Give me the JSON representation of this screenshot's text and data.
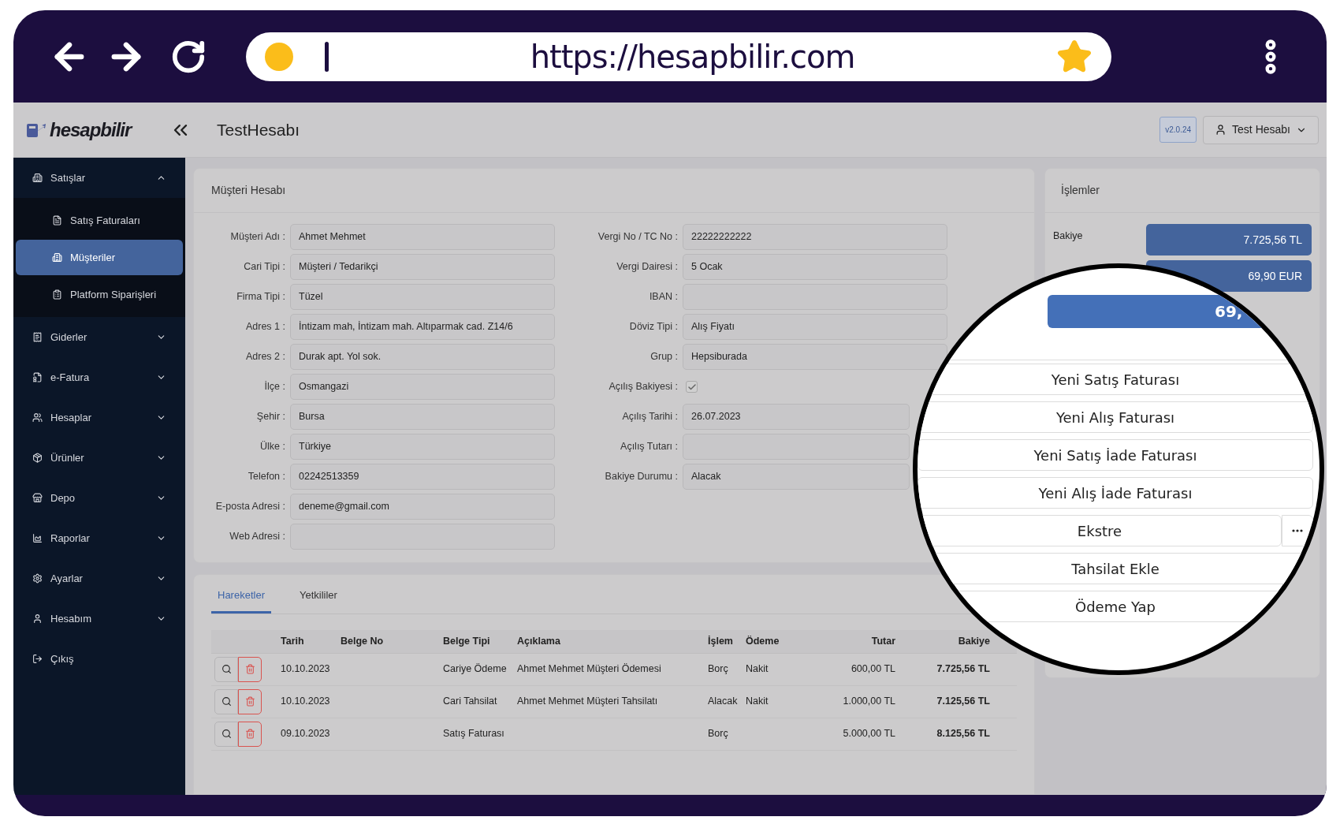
{
  "browser": {
    "url": "https://hesapbilir.com",
    "bookmarked": true
  },
  "header": {
    "logo": "hesapbilir",
    "title": "TestHesabı",
    "version": "v2.0.24",
    "user": "Test Hesabı"
  },
  "sidebar": {
    "items": [
      {
        "label": "Satışlar",
        "expanded": true,
        "selected": false,
        "children": [
          {
            "label": "Satış Faturaları",
            "selected": false
          },
          {
            "label": "Müşteriler",
            "selected": true
          },
          {
            "label": "Platform Siparişleri",
            "selected": false
          }
        ]
      },
      {
        "label": "Giderler",
        "expanded": false,
        "selected": false
      },
      {
        "label": "e-Fatura",
        "expanded": false,
        "selected": false
      },
      {
        "label": "Hesaplar",
        "expanded": false,
        "selected": false
      },
      {
        "label": "Ürünler",
        "expanded": false,
        "selected": false
      },
      {
        "label": "Depo",
        "expanded": false,
        "selected": false
      },
      {
        "label": "Raporlar",
        "expanded": false,
        "selected": false
      },
      {
        "label": "Ayarlar",
        "expanded": false,
        "selected": false
      },
      {
        "label": "Hesabım",
        "expanded": false,
        "selected": false
      },
      {
        "label": "Çıkış",
        "selected": false
      }
    ]
  },
  "customer_card": {
    "title": "Müşteri Hesabı",
    "left_fields": [
      {
        "label": "Müşteri Adı :",
        "value": "Ahmet Mehmet"
      },
      {
        "label": "Cari Tipi :",
        "value": "Müşteri / Tedarikçi"
      },
      {
        "label": "Firma Tipi :",
        "value": "Tüzel"
      },
      {
        "label": "Adres 1 :",
        "value": "İntizam mah, İntizam mah. Altıparmak cad. Z14/6"
      },
      {
        "label": "Adres 2 :",
        "value": "Durak apt. Yol sok."
      },
      {
        "label": "İlçe :",
        "value": "Osmangazi"
      },
      {
        "label": "Şehir :",
        "value": "Bursa"
      },
      {
        "label": "Ülke :",
        "value": "Türkiye"
      },
      {
        "label": "Telefon :",
        "value": "02242513359"
      },
      {
        "label": "E-posta Adresi :",
        "value": "deneme@gmail.com"
      },
      {
        "label": "Web Adresi :"
      }
    ],
    "right_fields": [
      {
        "kind": "text",
        "label": "Vergi No / TC No :",
        "value": "22222222222"
      },
      {
        "kind": "text",
        "label": "Vergi Dairesi :",
        "value": "5 Ocak"
      },
      {
        "kind": "text",
        "label": "IBAN :"
      },
      {
        "kind": "text",
        "label": "Döviz Tipi :",
        "value": "Alış Fiyatı"
      },
      {
        "kind": "text",
        "label": "Grup :",
        "value": "Hepsiburada"
      },
      {
        "kind": "checkbox",
        "label": "Açılış Bakiyesi :",
        "checked": true
      },
      {
        "kind": "text",
        "label": "Açılış Tarihi :",
        "value": "26.07.2023"
      },
      {
        "kind": "text",
        "label": "Açılış Tutarı :"
      },
      {
        "kind": "text",
        "label": "Bakiye Durumu :",
        "value": "Alacak"
      }
    ]
  },
  "movements": {
    "tabs": [
      {
        "label": "Hareketler",
        "selected": true
      },
      {
        "label": "Yetkililer",
        "selected": false
      }
    ],
    "columns": [
      "Tarih",
      "Belge No",
      "Belge Tipi",
      "Açıklama",
      "İşlem",
      "Ödeme",
      "Tutar",
      "Bakiye"
    ],
    "rows": [
      {
        "cells": [
          "10.10.2023",
          "",
          "Cariye Ödeme",
          "Ahmet Mehmet Müşteri Ödemesi",
          "Borç",
          "Nakit",
          "600,00 TL",
          "7.725,56 TL"
        ]
      },
      {
        "cells": [
          "10.10.2023",
          "",
          "Cari Tahsilat",
          "Ahmet Mehmet Müşteri Tahsilatı",
          "Alacak",
          "Nakit",
          "1.000,00 TL",
          "7.125,56 TL"
        ]
      },
      {
        "cells": [
          "09.10.2023",
          "",
          "Satış Faturası",
          "",
          "Borç",
          "",
          "5.000,00 TL",
          "8.125,56 TL"
        ]
      }
    ]
  },
  "actions_panel": {
    "title": "İşlemler",
    "balances": [
      {
        "label": "Bakiye",
        "value": "7.725,56 TL"
      },
      {
        "value": "69,90 EUR"
      }
    ]
  },
  "magnifier": {
    "balance": "69,",
    "buttons": [
      {
        "label": "Yeni Satış Faturası"
      },
      {
        "label": "Yeni Alış Faturası"
      },
      {
        "label": "Yeni Satış İade Faturası"
      },
      {
        "label": "Yeni Alış İade Faturası"
      },
      {
        "label": "Ekstre",
        "has_menu": true
      },
      {
        "label": "Tahsilat Ekle"
      },
      {
        "label": "Ödeme Yap"
      }
    ]
  }
}
